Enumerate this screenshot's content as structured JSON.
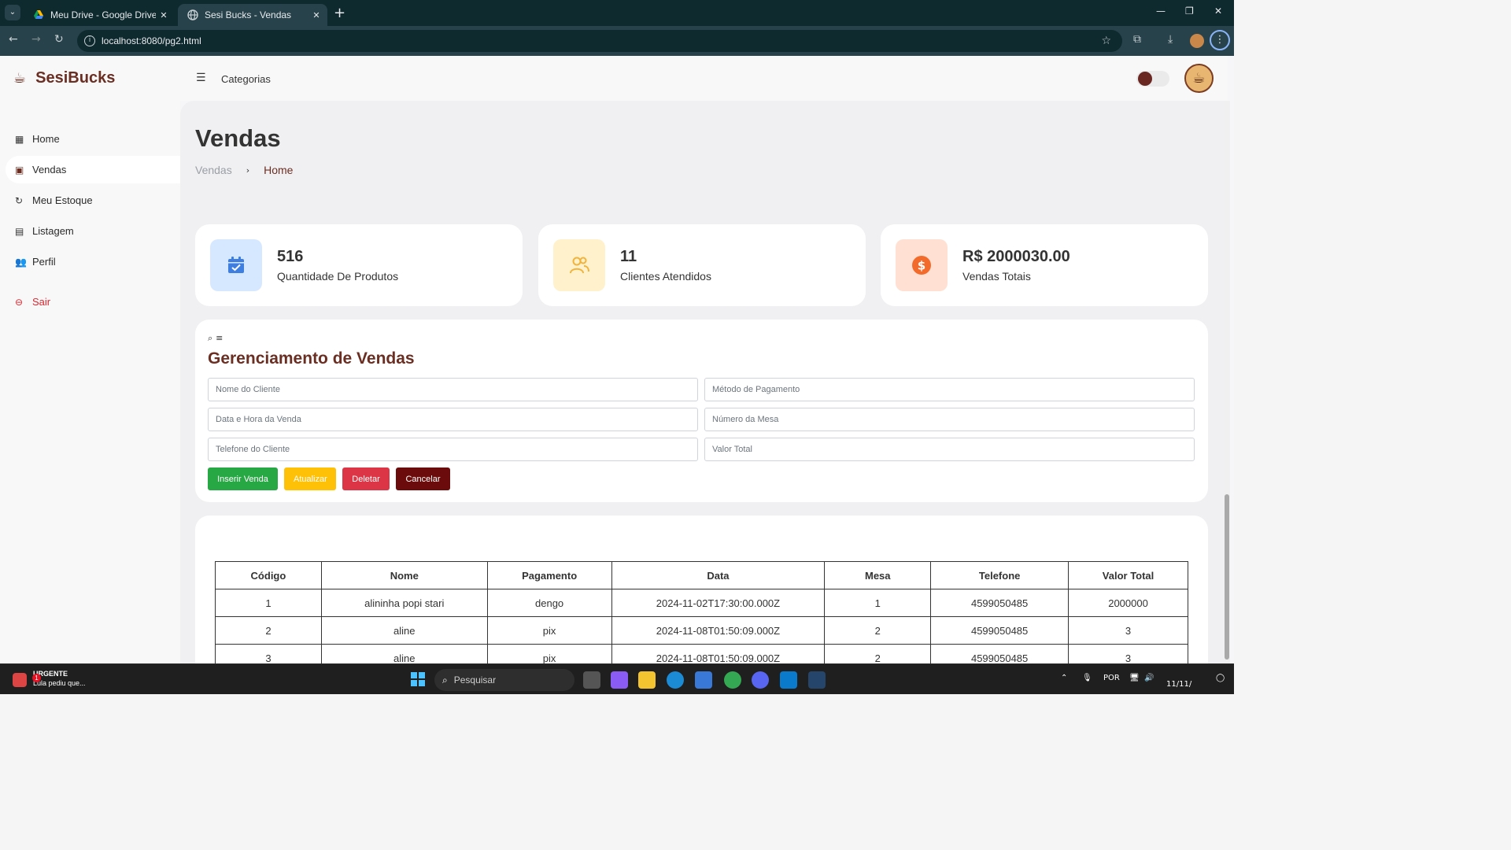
{
  "browser": {
    "tabs": [
      {
        "title": "Meu Drive - Google Drive"
      },
      {
        "title": "Sesi Bucks - Vendas"
      }
    ],
    "url": "localhost:8080/pg2.html"
  },
  "app": {
    "brand": "SesiBucks",
    "top_link": "Categorias",
    "sidebar": [
      {
        "label": "Home"
      },
      {
        "label": "Vendas"
      },
      {
        "label": "Meu Estoque"
      },
      {
        "label": "Listagem"
      },
      {
        "label": "Perfil"
      },
      {
        "label": "Sair"
      }
    ],
    "page_title": "Vendas",
    "breadcrumb": [
      "Vendas",
      "Home"
    ],
    "stats": [
      {
        "value": "516",
        "label": "Quantidade De Produtos",
        "color": "#3d7ee0",
        "bg": "#d6e8ff"
      },
      {
        "value": "11",
        "label": "Clientes Atendidos",
        "color": "#f2b33b",
        "bg": "#fff1cc"
      },
      {
        "value": "R$ 2000030.00",
        "label": "Vendas Totais",
        "color": "#f26b2a",
        "bg": "#ffe0d3"
      }
    ],
    "form": {
      "heading": "Gerenciamento de Vendas",
      "placeholders": {
        "nome": "Nome do Cliente",
        "metodo": "Método de Pagamento",
        "data": "Data e Hora da Venda",
        "mesa": "Número da Mesa",
        "telefone": "Telefone do Cliente",
        "valor": "Valor Total"
      },
      "buttons": {
        "insert": "Inserir Venda",
        "update": "Atualizar",
        "delete": "Deletar",
        "cancel": "Cancelar"
      }
    },
    "table": {
      "headers": [
        "Código",
        "Nome",
        "Pagamento",
        "Data",
        "Mesa",
        "Telefone",
        "Valor Total"
      ],
      "rows": [
        [
          "1",
          "alininha popi stari",
          "dengo",
          "2024-11-02T17:30:00.000Z",
          "1",
          "4599050485",
          "2000000"
        ],
        [
          "2",
          "aline",
          "pix",
          "2024-11-08T01:50:09.000Z",
          "2",
          "4599050485",
          "3"
        ],
        [
          "3",
          "aline",
          "pix",
          "2024-11-08T01:50:09.000Z",
          "2",
          "4599050485",
          "3"
        ]
      ]
    }
  },
  "taskbar": {
    "notification_title": "URGENTE",
    "notification_text": "Lula pediu que...",
    "notification_badge": "1",
    "search_placeholder": "Pesquisar",
    "language": "POR",
    "date": "11/11/"
  }
}
